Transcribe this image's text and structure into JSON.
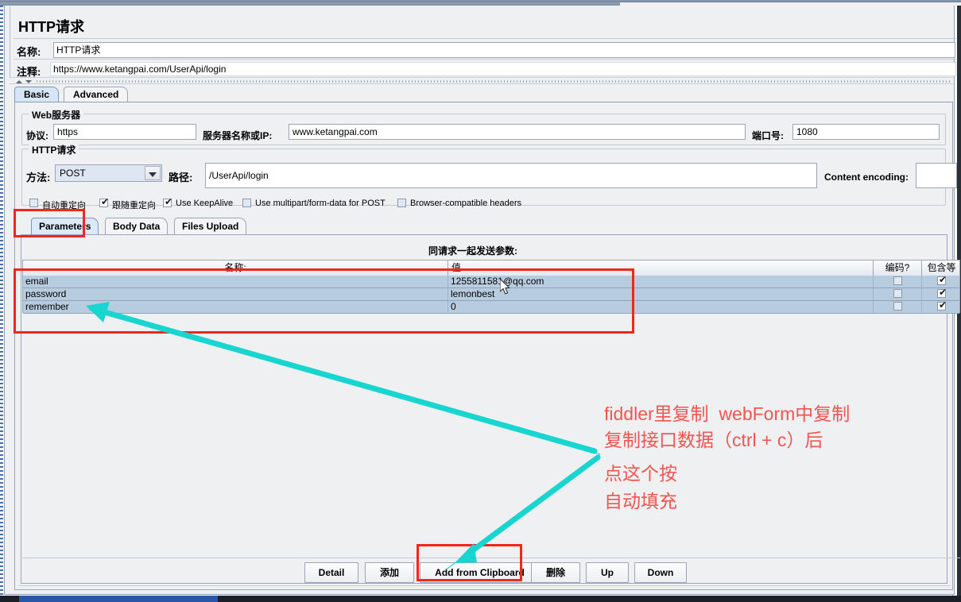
{
  "window": {
    "title": "HTTP请求",
    "name_label": "名称:",
    "name_value": "HTTP请求",
    "comment_label": "注释:",
    "comment_value": "https://www.ketangpai.com/UserApi/login"
  },
  "tabs": [
    {
      "label": "Basic",
      "selected": true
    },
    {
      "label": "Advanced",
      "selected": false
    }
  ],
  "web_server": {
    "group_title": "Web服务器",
    "protocol_label": "协议:",
    "protocol_value": "https",
    "server_label": "服务器名称或IP:",
    "server_value": "www.ketangpai.com",
    "port_label": "端口号:",
    "port_value": "1080"
  },
  "http_request": {
    "group_title": "HTTP请求",
    "method_label": "方法:",
    "method_value": "POST",
    "path_label": "路径:",
    "path_value": "/UserApi/login",
    "content_encoding_label": "Content encoding:",
    "content_encoding_value": "",
    "checkboxes": [
      {
        "label": "自动重定向",
        "checked": false
      },
      {
        "label": "跟随重定向",
        "checked": true
      },
      {
        "label": "Use KeepAlive",
        "checked": true
      },
      {
        "label": "Use multipart/form-data for POST",
        "checked": false
      },
      {
        "label": "Browser-compatible headers",
        "checked": false
      }
    ]
  },
  "inner_tabs": [
    {
      "label": "Parameters",
      "selected": true
    },
    {
      "label": "Body Data",
      "selected": false
    },
    {
      "label": "Files Upload",
      "selected": false
    }
  ],
  "parameters": {
    "caption": "同请求一起发送参数:",
    "columns": [
      "名称:",
      "值",
      "编码?",
      "包含等于?"
    ],
    "rows": [
      {
        "name": "email",
        "value": "1255811581@qq.com",
        "encode": false,
        "include_equals": true
      },
      {
        "name": "password",
        "value": "lemonbest",
        "encode": false,
        "include_equals": true
      },
      {
        "name": "remember",
        "value": "0",
        "encode": false,
        "include_equals": true
      }
    ]
  },
  "buttons": [
    {
      "label": "Detail"
    },
    {
      "label": "添加"
    },
    {
      "label": "Add from Clipboard"
    },
    {
      "label": "删除"
    },
    {
      "label": "Up"
    },
    {
      "label": "Down"
    }
  ],
  "annotations": {
    "note_lines": [
      "fiddler里复制  webForm中复制",
      "复制接口数据（ctrl + c）后",
      "点这个按",
      "自动填充"
    ],
    "colors": {
      "highlight_red": "#f4251b",
      "note_red": "#f2554f",
      "arrow_teal": "#18d6cf"
    }
  }
}
